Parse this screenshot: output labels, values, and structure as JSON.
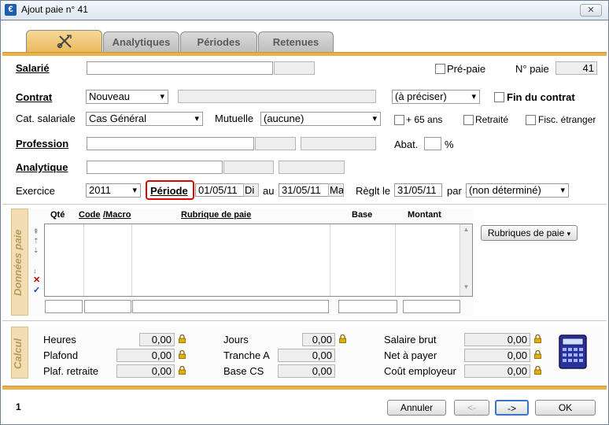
{
  "window": {
    "title": "Ajout paie n° 41",
    "close": "✕",
    "app_icon": "€"
  },
  "tabs": [
    {
      "label": "",
      "icon": "tools-icon"
    },
    {
      "label": "Analytiques"
    },
    {
      "label": "Périodes"
    },
    {
      "label": "Retenues"
    }
  ],
  "salarie": {
    "label": "Salarié",
    "value": "",
    "code": ""
  },
  "prepaie": {
    "label": "Pré-paie",
    "checked": false
  },
  "numero": {
    "label": "N° paie",
    "value": "41"
  },
  "contrat": {
    "label": "Contrat",
    "value": "Nouveau",
    "detail": "",
    "type": "(à préciser)"
  },
  "fin_contrat": {
    "label": "Fin du contrat",
    "checked": false
  },
  "cat": {
    "label": "Cat. salariale",
    "value": "Cas Général"
  },
  "mutuelle": {
    "label": "Mutuelle",
    "value": "(aucune)"
  },
  "plus65": {
    "label": "+ 65 ans"
  },
  "retraite": {
    "label": "Retraité"
  },
  "fisc": {
    "label": "Fisc. étranger"
  },
  "profession": {
    "label": "Profession",
    "value": ""
  },
  "abat": {
    "label": "Abat.",
    "value": "",
    "unit": "%"
  },
  "analytique": {
    "label": "Analytique",
    "value": ""
  },
  "exercice": {
    "label": "Exercice",
    "value": "2011"
  },
  "periode": {
    "label": "Période",
    "from": "01/05/11",
    "from_day": "Di",
    "au": "au",
    "to": "31/05/11",
    "to_day": "Ma"
  },
  "reglt": {
    "label": "Règlt le",
    "date": "31/05/11",
    "par": "par",
    "mode": "(non déterminé)"
  },
  "donnees": {
    "side_label": "Données paie",
    "headers": {
      "qte": "Qté",
      "code": "Code",
      "macro": "/Macro",
      "rubrique": "Rubrique de paie",
      "base": "Base",
      "montant": "Montant"
    },
    "rubriques_button": "Rubriques de paie"
  },
  "calcul": {
    "side_label": "Calcul",
    "heures": {
      "label": "Heures",
      "value": "0,00"
    },
    "plafond": {
      "label": "Plafond",
      "value": "0,00"
    },
    "plaf_retraite": {
      "label": "Plaf. retraite",
      "value": "0,00"
    },
    "jours": {
      "label": "Jours",
      "value": "0,00"
    },
    "tranche_a": {
      "label": "Tranche A",
      "value": "0,00"
    },
    "base_cs": {
      "label": "Base CS",
      "value": "0,00"
    },
    "salaire_brut": {
      "label": "Salaire brut",
      "value": "0,00"
    },
    "net_payer": {
      "label": "Net à payer",
      "value": "0,00"
    },
    "cout_employeur": {
      "label": "Coût employeur",
      "value": "0,00"
    }
  },
  "footer": {
    "page": "1",
    "annuler": "Annuler",
    "prev": "<-",
    "next": "->",
    "ok": "OK"
  },
  "colors": {
    "accent": "#e7b24c",
    "tab_active": "#eab85a",
    "side_panel": "#f2deb2",
    "highlight_border": "#e00000"
  }
}
